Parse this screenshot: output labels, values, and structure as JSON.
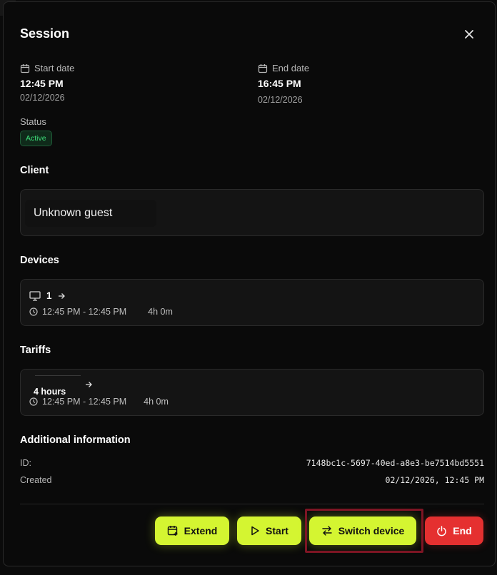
{
  "dialog": {
    "title": "Session"
  },
  "session": {
    "start_label": "Start date",
    "start_time": "12:45 PM",
    "start_date": "02/12/2026",
    "end_label": "End date",
    "end_time": "16:45 PM",
    "end_date": "02/12/2026",
    "status_label": "Status",
    "status_value": "Active"
  },
  "client": {
    "section_title": "Client",
    "name": "Unknown guest"
  },
  "devices": {
    "section_title": "Devices",
    "items": [
      {
        "name": "1",
        "time_range": "12:45 PM - 12:45 PM",
        "duration": "4h 0m"
      }
    ]
  },
  "tariffs": {
    "section_title": "Tariffs",
    "items": [
      {
        "name": "4 hours",
        "time_range": "12:45 PM - 12:45 PM",
        "duration": "4h 0m"
      }
    ]
  },
  "additional": {
    "section_title": "Additional information",
    "id_label": "ID:",
    "id_value": "7148bc1c-5697-40ed-a8e3-be7514bd5551",
    "created_label": "Created",
    "created_value": "02/12/2026, 12:45 PM"
  },
  "actions": {
    "extend_label": "Extend",
    "start_label": "Start",
    "switch_label": "Switch device",
    "end_label": "End"
  },
  "colors": {
    "accent": "#d4f531",
    "danger": "#e53030",
    "status_active": "#3ee07a"
  },
  "icons": {
    "close": "close-icon",
    "calendar": "calendar-icon",
    "monitor": "monitor-icon",
    "clock": "clock-icon",
    "arrow_right": "arrow-right-icon",
    "extend": "calendar-plus-icon",
    "play": "play-icon",
    "switch": "switch-arrows-icon",
    "power": "power-icon"
  }
}
